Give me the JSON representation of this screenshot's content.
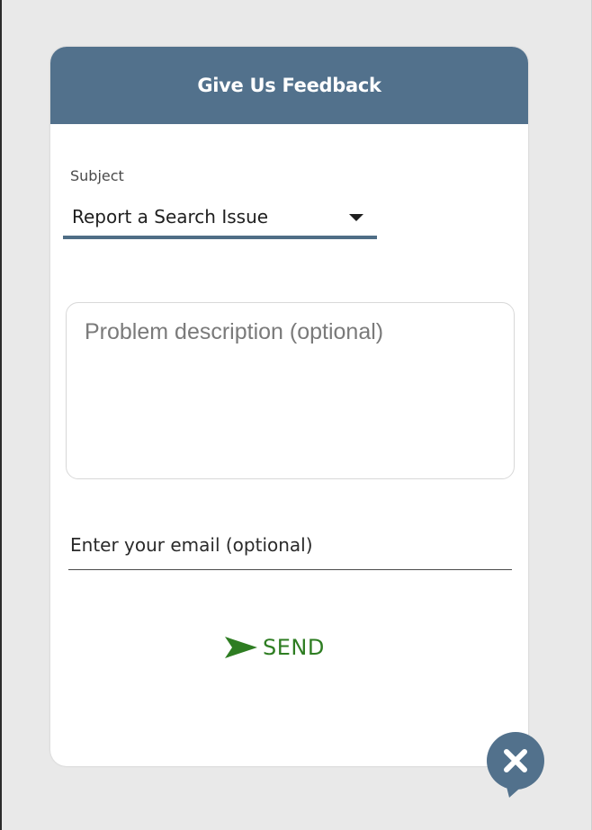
{
  "dialog": {
    "title": "Give Us Feedback"
  },
  "subject": {
    "label": "Subject",
    "selected": "Report a Search Issue"
  },
  "description": {
    "placeholder": "Problem description (optional)"
  },
  "email": {
    "placeholder": "Enter your email (optional)"
  },
  "send": {
    "label": "SEND",
    "icon": "send-arrow-icon"
  },
  "close": {
    "icon": "close-icon"
  },
  "colors": {
    "header": "#52718c",
    "accent_underline": "#4f6e86",
    "send": "#2e7d22",
    "fab": "#52718c"
  }
}
